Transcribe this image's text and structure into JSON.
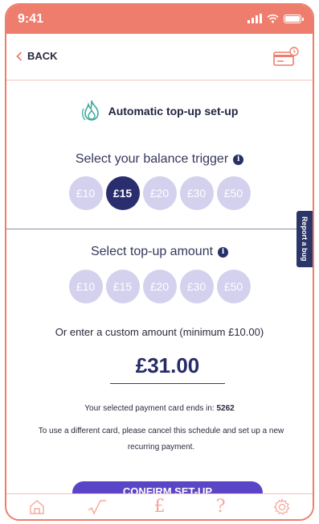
{
  "status_bar": {
    "time": "9:41"
  },
  "header": {
    "back_label": "BACK"
  },
  "title": "Automatic top-up set-up",
  "trigger": {
    "label": "Select your balance trigger",
    "options": [
      "£10",
      "£15",
      "£20",
      "£30",
      "£50"
    ],
    "selected": "£15"
  },
  "topup": {
    "label": "Select top-up amount",
    "options": [
      "£10",
      "£15",
      "£20",
      "£30",
      "£50"
    ],
    "selected": null
  },
  "custom": {
    "label": "Or enter a custom amount (minimum £10.00)",
    "value": "£31.00"
  },
  "payment": {
    "card_prefix": "Your selected payment card ends in:",
    "card_last4": "5262",
    "note": "To use a different card, please cancel this schedule and set up a new recurring payment."
  },
  "confirm_label": "CONFIRM SET-UP",
  "bug_tab_label": "Report a bug",
  "tabbar": {
    "items": [
      "home-icon",
      "chart-icon",
      "pound-icon",
      "help-icon",
      "settings-icon"
    ],
    "pound_glyph": "£",
    "help_glyph": "?"
  },
  "colors": {
    "accent": "#ee7d6d",
    "pill_default": "#d3d1ee",
    "pill_selected": "#2a2d6e",
    "confirm": "#5a45c6"
  }
}
